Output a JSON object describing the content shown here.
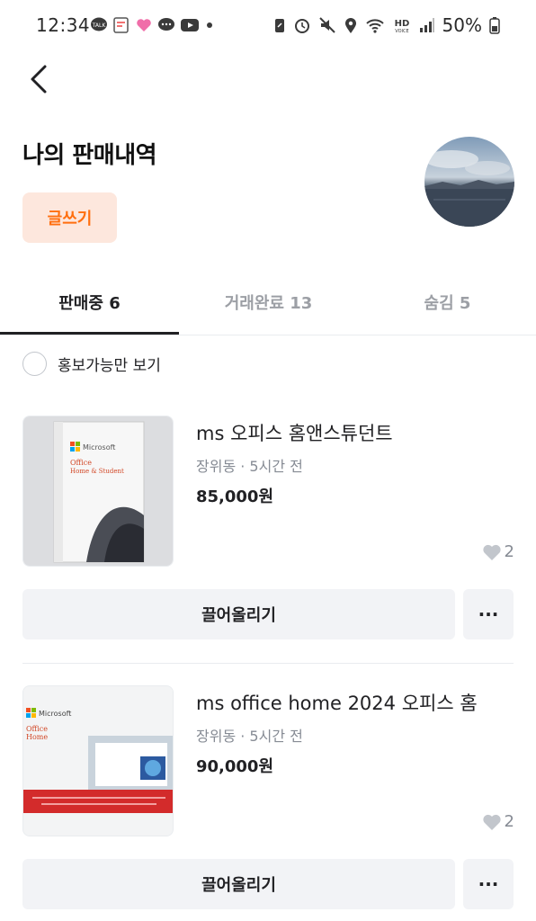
{
  "status_bar": {
    "time": "12:34",
    "battery": "50%",
    "left_icons": [
      "talk-icon",
      "note-icon",
      "heart-icon",
      "message-icon",
      "youtube-icon",
      "dot-icon"
    ],
    "right_icons": [
      "battery-saver-icon",
      "alarm-icon",
      "mute-icon",
      "location-icon",
      "wifi-icon",
      "hd-voice-icon",
      "signal-icon"
    ]
  },
  "header": {
    "back_icon": "chevron-left-icon",
    "title": "나의 판매내역",
    "write_button": "글쓰기"
  },
  "tabs": [
    {
      "label": "판매중 6",
      "active": true
    },
    {
      "label": "거래완료 13",
      "active": false
    },
    {
      "label": "숨김 5",
      "active": false
    }
  ],
  "filter": {
    "label": "홍보가능만 보기",
    "checked": false
  },
  "items": [
    {
      "title": "ms 오피스 홈앤스튜던트",
      "meta": "장위동 · 5시간 전",
      "price": "85,000원",
      "likes": "2",
      "bump_label": "끌어올리기",
      "more_label": "···",
      "thumb_text": "Microsoft",
      "thumb_subtext": "Office",
      "thumb_subtext2": "Home & Student"
    },
    {
      "title": "ms office home 2024 오피스 홈",
      "meta": "장위동 · 5시간 전",
      "price": "90,000원",
      "likes": "2",
      "bump_label": "끌어올리기",
      "more_label": "···",
      "thumb_text": "Microsoft",
      "thumb_subtext": "Office",
      "thumb_subtext2": "Home"
    }
  ],
  "colors": {
    "accent": "#ff6f0f",
    "accent_bg": "#fde7dd",
    "button_bg": "#f2f3f6",
    "muted_text": "#868b94"
  }
}
